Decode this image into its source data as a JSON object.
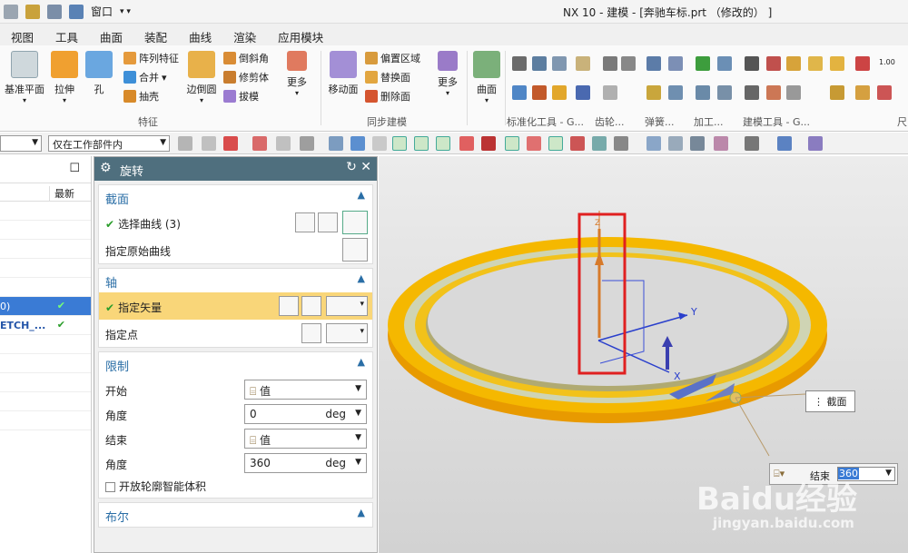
{
  "titlebar": {
    "window_menu": "窗口",
    "title": "NX 10 - 建模 - [奔驰车标.prt （修改的） ]"
  },
  "menu": [
    "视图",
    "工具",
    "曲面",
    "装配",
    "曲线",
    "渲染",
    "应用模块"
  ],
  "ribbon": {
    "datum_plane": "基准平面",
    "extrude": "拉伸",
    "hole": "孔",
    "pattern_feature": "阵列特征",
    "unite": "合并",
    "shell": "抽壳",
    "edge_blend": "边倒圆",
    "chamfer": "倒斜角",
    "trim_body": "修剪体",
    "draft": "拔模",
    "more1": "更多",
    "feature_group": "特征",
    "move_face": "移动面",
    "offset_region": "偏置区域",
    "replace_face": "替换面",
    "delete_face": "删除面",
    "more2": "更多",
    "sync_group": "同步建模",
    "surface": "曲面",
    "std_tools_group": "标准化工具 - G...",
    "gear_group": "齿轮...",
    "spring_group": "弹簧...",
    "machining_group": "加工...",
    "build_tools_group": "建模工具 - G...",
    "dim_label": "尺",
    "val_100": "1.00"
  },
  "toolbar2": {
    "filter_value": "",
    "scope_value": "仅在工作部件内"
  },
  "navigator": {
    "col_latest": "最新",
    "rows": [
      {
        "name": "",
        "latest": ""
      },
      {
        "name": "",
        "latest": ""
      },
      {
        "name": "",
        "latest": ""
      },
      {
        "name": "",
        "latest": ""
      },
      {
        "name": "0)",
        "latest": "✔"
      },
      {
        "name": "ETCH_...",
        "latest": "✔"
      }
    ]
  },
  "dialog": {
    "title": "旋转",
    "section_label": "截面",
    "select_curve": "选择曲线 (3)",
    "specify_origin_curve": "指定原始曲线",
    "axis_label": "轴",
    "specify_vector": "指定矢量",
    "specify_point": "指定点",
    "limits_label": "限制",
    "start_label": "开始",
    "start_type": "值",
    "angle_label": "角度",
    "start_angle": "0",
    "end_label": "结束",
    "end_type": "值",
    "angle2_label": "角度",
    "end_angle": "360",
    "unit": "deg",
    "open_profile": "开放轮廓智能体积",
    "bool_label": "布尔"
  },
  "viewport": {
    "tooltip_section": "截面",
    "end_tag_label": "结束",
    "end_tag_value": "360",
    "axis_y": "Y",
    "axis_x": "X",
    "axis_z": "Z"
  },
  "watermark": {
    "brand": "Baidu经验",
    "url": "jingyan.baidu.com"
  },
  "colors": {
    "accent": "#4f6f7e",
    "highlight": "#f9d679",
    "ring": "#f5b800",
    "red_box": "#e02020"
  }
}
